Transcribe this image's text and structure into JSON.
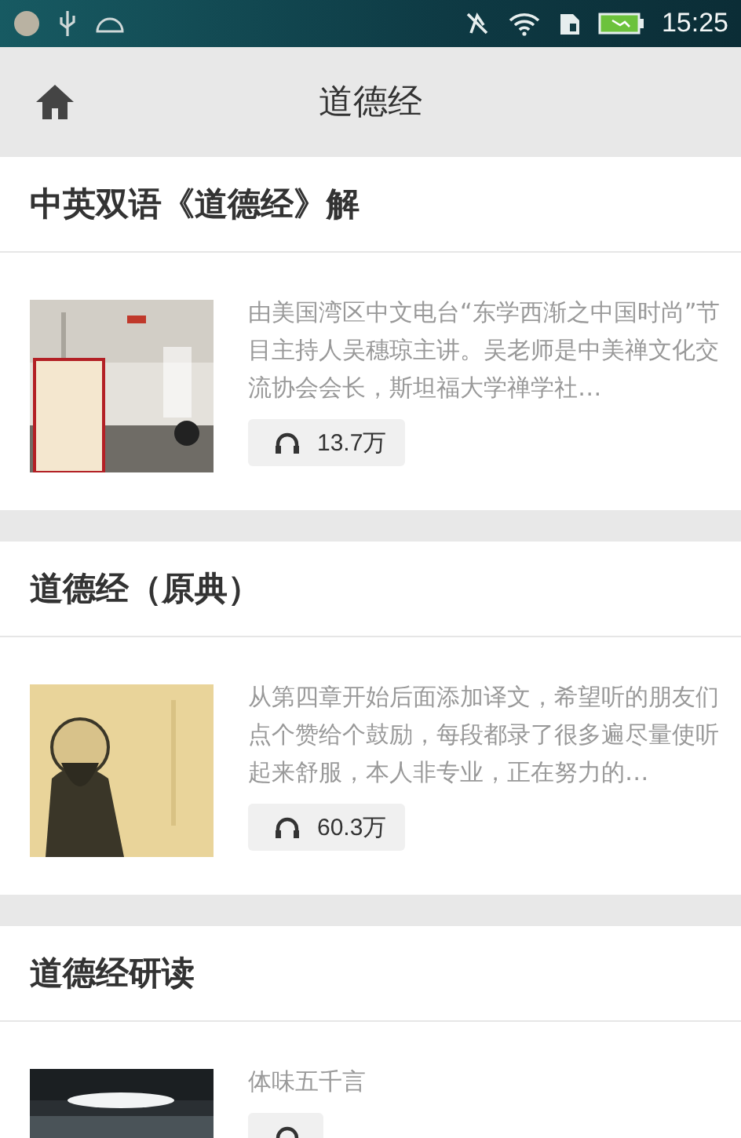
{
  "status_bar": {
    "time": "15:25"
  },
  "toolbar": {
    "title": "道德经"
  },
  "sections": [
    {
      "title": "中英双语《道德经》解",
      "items": [
        {
          "kind": "book",
          "description": "由美国湾区中文电台“东学西渐之中国时尚”节目主持人吴穗琼主讲。吴老师是中美禅文化交流协会会长，斯坦福大学禅学社…",
          "plays": "13.7万"
        }
      ]
    },
    {
      "title": "道德经（原典）",
      "items": [
        {
          "kind": "sage",
          "description": "从第四章开始后面添加译文，希望听的朋友们点个赞给个鼓励，每段都录了很多遍尽量使听起来舒服，本人非专业，正在努力的…",
          "plays": "60.3万"
        }
      ]
    },
    {
      "title": "道德经研读",
      "items": [
        {
          "kind": "night",
          "description": "体味五千言"
        }
      ]
    }
  ]
}
